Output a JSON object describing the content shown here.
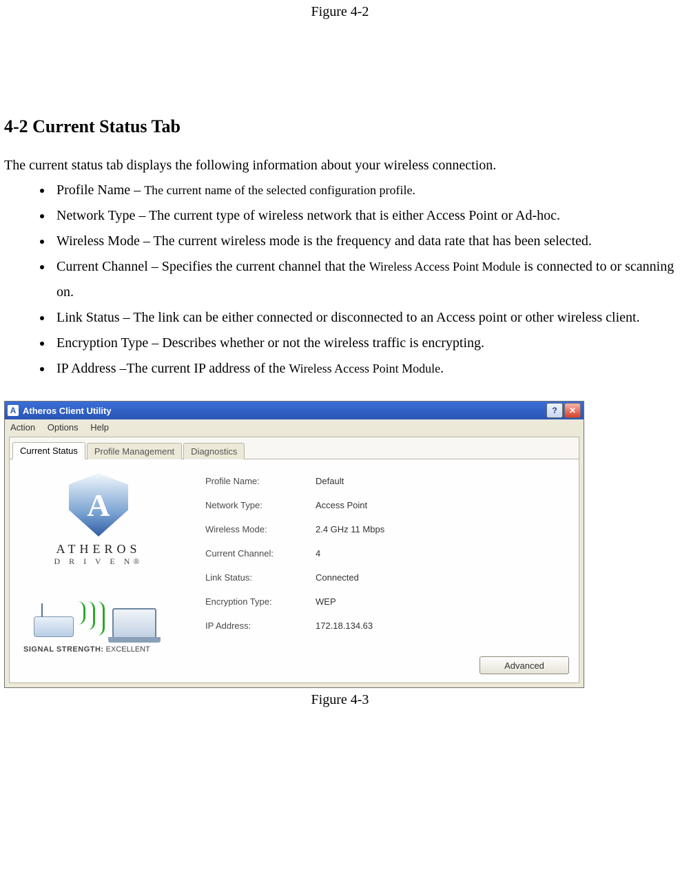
{
  "top_caption": "Figure 4-2",
  "section_heading": "4-2 Current Status Tab",
  "intro": "The current status tab displays the following information about your wireless connection.",
  "bullets": [
    {
      "term": "Profile Name",
      "desc_pre": " – ",
      "desc": "The current name of the selected configuration profile.",
      "desc_small": true
    },
    {
      "term": "Network Type",
      "desc_pre": " – ",
      "desc": "The current type of wireless network that is either Access Point or Ad-hoc."
    },
    {
      "term": "Wireless Mode",
      "desc_pre": " – ",
      "desc": "The current wireless mode is the frequency and data rate that has been selected."
    },
    {
      "term": "Current Channel",
      "desc_pre": " – ",
      "desc_a": "Specifies the current channel that the ",
      "desc_b": "Wireless Access Point Module",
      "desc_c": " is connected to or scanning on.",
      "mixed": true
    },
    {
      "term": "Link Status",
      "desc_pre": " – ",
      "desc": "The link can be either connected or disconnected to an Access point or other wireless client."
    },
    {
      "term": "Encryption Type",
      "desc_pre": " – ",
      "desc": "Describes whether or not the wireless traffic is encrypting."
    },
    {
      "term": "IP Address",
      "desc_pre": " –",
      "desc_a": "The current IP address of the ",
      "desc_b": "Wireless Access Point Module",
      "desc_c": ".",
      "mixed": true
    }
  ],
  "dialog": {
    "title": "Atheros Client Utility",
    "menu": {
      "action": "Action",
      "options": "Options",
      "help": "Help"
    },
    "tabs": {
      "current": "Current Status",
      "profile": "Profile Management",
      "diag": "Diagnostics"
    },
    "logo": {
      "letter": "A",
      "line1": "ATHEROS",
      "line2": "D R I V E N®"
    },
    "signal": {
      "label": "SIGNAL STRENGTH:",
      "value": "EXCELLENT"
    },
    "fields": {
      "profile_label": "Profile Name:",
      "profile_value": "Default",
      "nettype_label": "Network Type:",
      "nettype_value": "Access Point",
      "wmode_label": "Wireless Mode:",
      "wmode_value": "2.4 GHz 11 Mbps",
      "chan_label": "Current Channel:",
      "chan_value": "4",
      "link_label": "Link Status:",
      "link_value": "Connected",
      "enc_label": "Encryption Type:",
      "enc_value": "WEP",
      "ip_label": "IP Address:",
      "ip_value": "172.18.134.63"
    },
    "advanced_btn": "Advanced"
  },
  "bottom_caption": "Figure 4-3"
}
